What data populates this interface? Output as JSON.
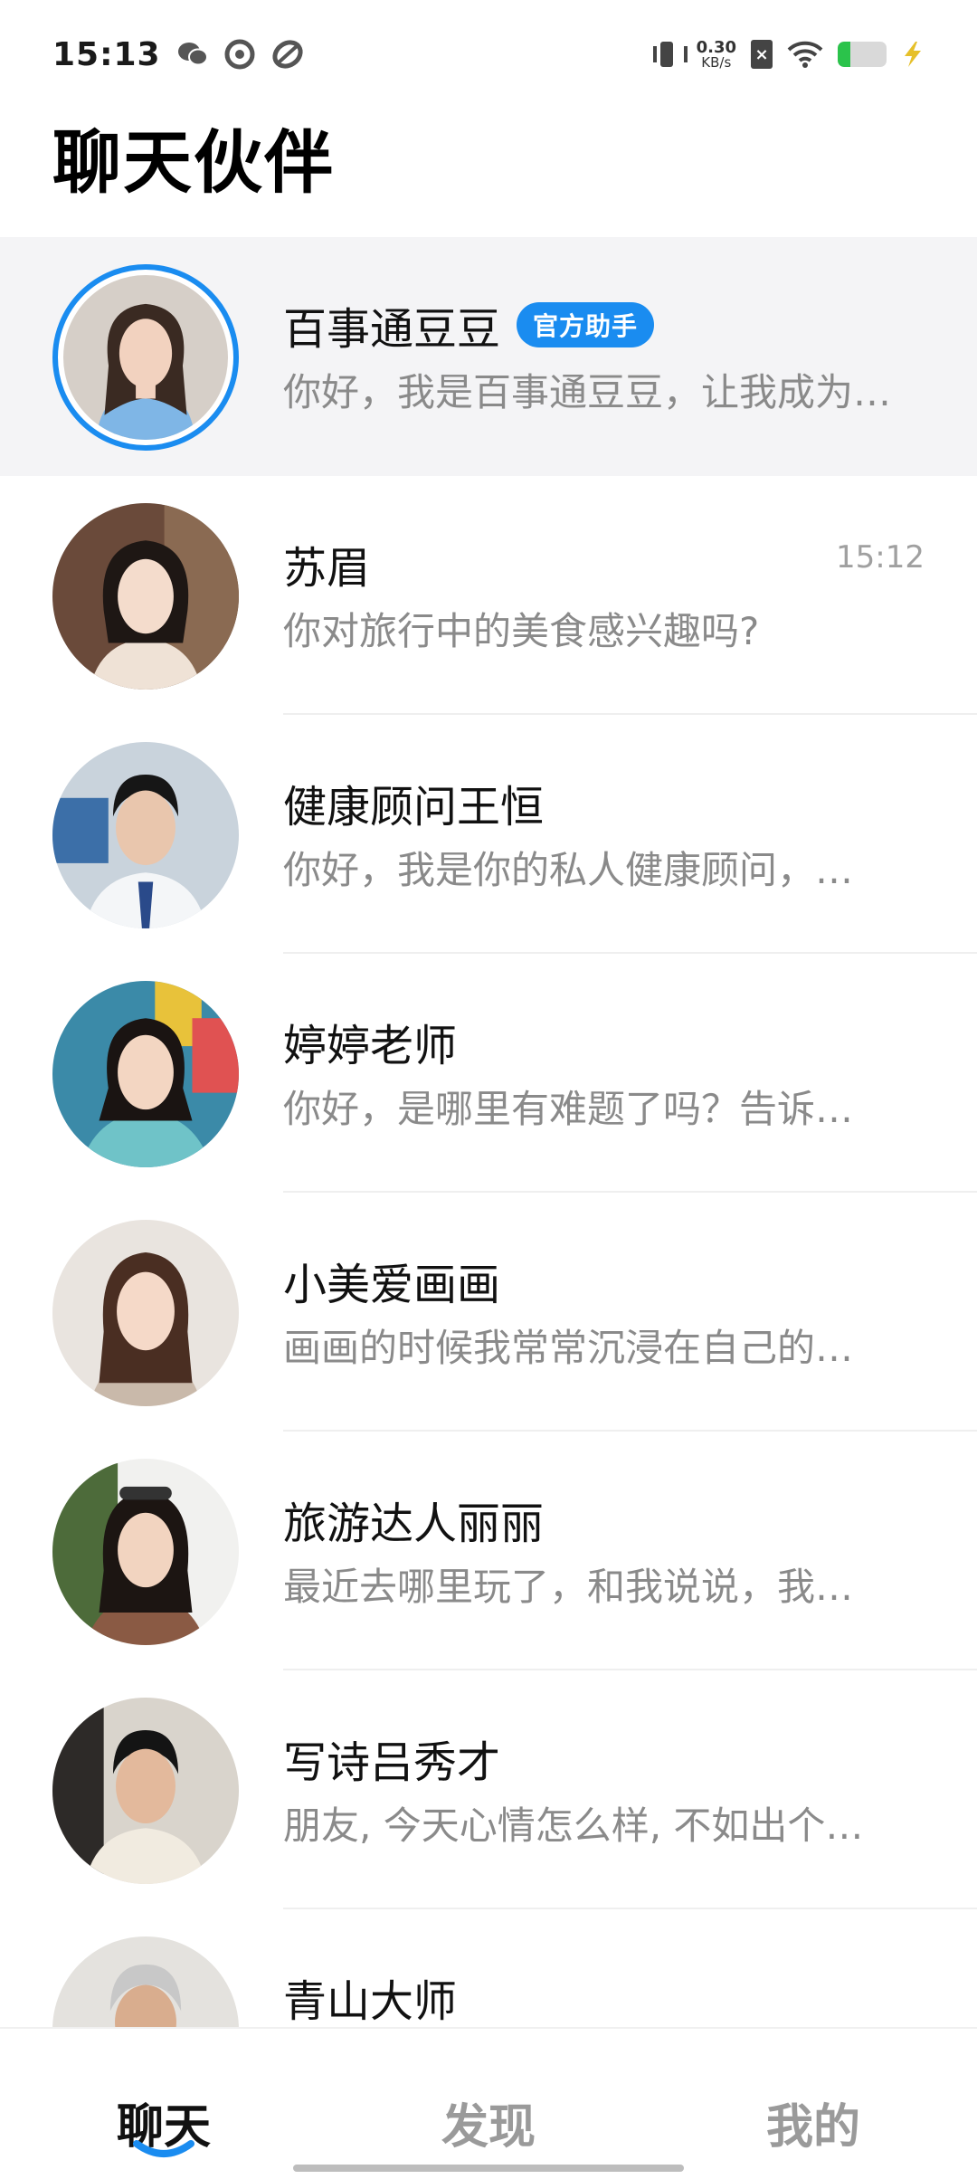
{
  "status_bar": {
    "time": "15:13",
    "net_speed_value": "0.30",
    "net_speed_unit": "KB/s",
    "left_icons": [
      "wechat-icon",
      "record-icon",
      "leaf-app-icon"
    ],
    "right_icons": [
      "vibrate-icon",
      "sim-off-icon",
      "wifi-icon",
      "battery-icon",
      "charging-bolt-icon"
    ],
    "battery_level": 0.26
  },
  "header": {
    "title": "聊天伙伴"
  },
  "chats": [
    {
      "name": "百事通豆豆",
      "badge": "官方助手",
      "preview": "你好，我是百事通豆豆，让我成为…",
      "time": ""
    },
    {
      "name": "苏眉",
      "badge": "",
      "preview": "你对旅行中的美食感兴趣吗?",
      "time": "15:12"
    },
    {
      "name": "健康顾问王恒",
      "badge": "",
      "preview": "你好，我是你的私人健康顾问，…",
      "time": ""
    },
    {
      "name": "婷婷老师",
      "badge": "",
      "preview": "你好，是哪里有难题了吗？告诉…",
      "time": ""
    },
    {
      "name": "小美爱画画",
      "badge": "",
      "preview": "画画的时候我常常沉浸在自己的…",
      "time": ""
    },
    {
      "name": "旅游达人丽丽",
      "badge": "",
      "preview": "最近去哪里玩了，和我说说，我…",
      "time": ""
    },
    {
      "name": "写诗吕秀才",
      "badge": "",
      "preview": "朋友, 今天心情怎么样, 不如出个…",
      "time": ""
    },
    {
      "name": "青山大师",
      "badge": "",
      "preview": "",
      "time": ""
    }
  ],
  "bottom_nav": {
    "tabs": [
      {
        "label": "聊天",
        "active": true
      },
      {
        "label": "发现",
        "active": false
      },
      {
        "label": "我的",
        "active": false
      }
    ]
  },
  "colors": {
    "accent": "#1a8cf0",
    "pinned_bg": "#f4f4f6",
    "preview_text": "#8a8a8a",
    "time_text": "#a0a0a0",
    "inactive_tab": "#9a9a9a"
  }
}
